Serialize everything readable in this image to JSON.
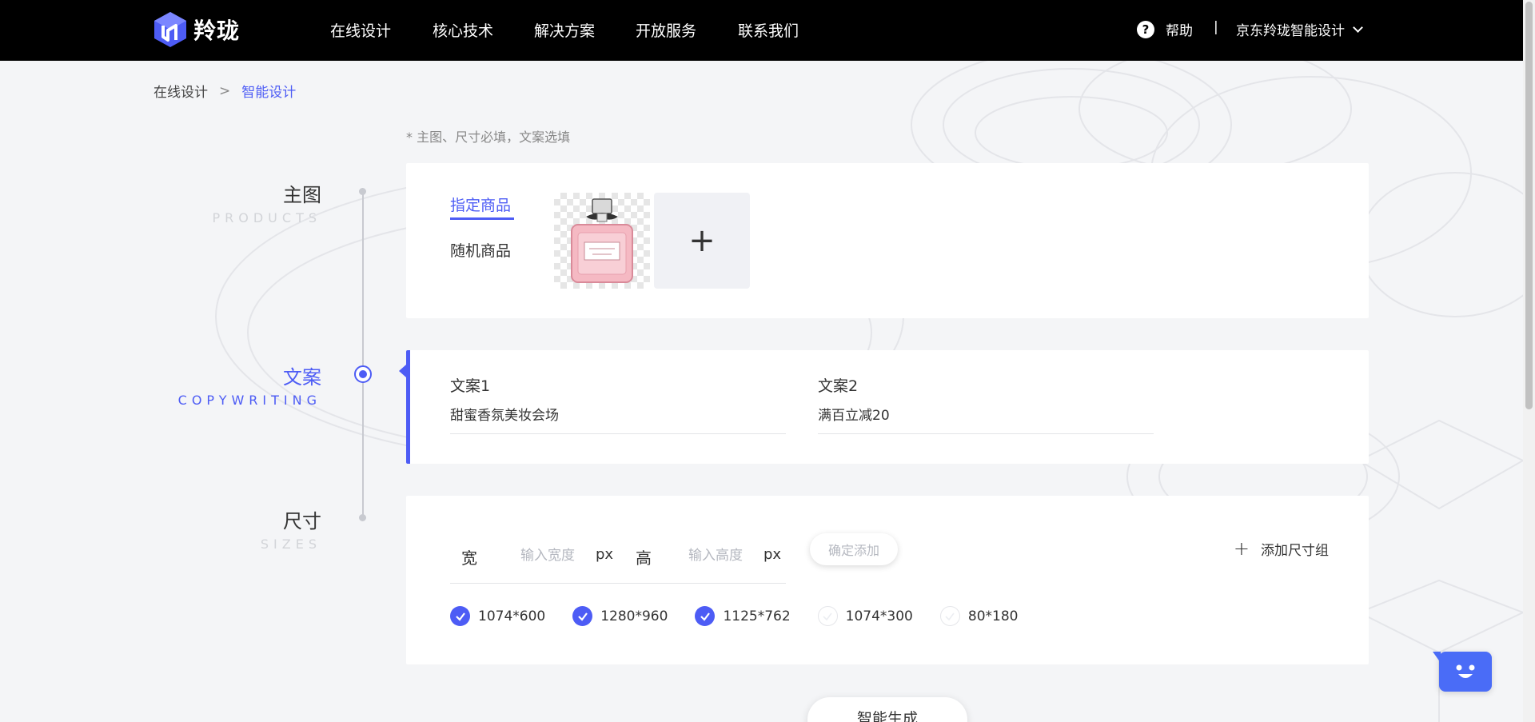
{
  "brand": {
    "logo_text": "羚珑",
    "accent_color": "#4d5cf5"
  },
  "nav": {
    "items": [
      "在线设计",
      "核心技术",
      "解决方案",
      "开放服务",
      "联系我们"
    ],
    "help_label": "帮助",
    "separator": "|",
    "account_label": "京东羚珑智能设计"
  },
  "breadcrumb": {
    "parent": "在线设计",
    "separator": ">",
    "current": "智能设计"
  },
  "required_note": "* 主图、尺寸必填，文案选填",
  "steps": [
    {
      "title": "主图",
      "subtitle": "PRODUCTS",
      "active": false
    },
    {
      "title": "文案",
      "subtitle": "COPYWRITING",
      "active": true
    },
    {
      "title": "尺寸",
      "subtitle": "SIZES",
      "active": false
    }
  ],
  "products": {
    "tabs": [
      "指定商品",
      "随机商品"
    ],
    "selected_tab": "指定商品",
    "add_symbol": "+"
  },
  "copywriting": {
    "fields": [
      {
        "label": "文案1",
        "value": "甜蜜香氛美妆会场"
      },
      {
        "label": "文案2",
        "value": "满百立减20"
      }
    ]
  },
  "sizes": {
    "width_label": "宽",
    "width_placeholder": "输入宽度",
    "height_label": "高",
    "height_placeholder": "输入高度",
    "unit": "px",
    "confirm_label": "确定添加",
    "add_group_label": "添加尺寸组",
    "add_group_symbol": "+",
    "options": [
      {
        "label": "1074*600",
        "checked": true
      },
      {
        "label": "1280*960",
        "checked": true
      },
      {
        "label": "1125*762",
        "checked": true
      },
      {
        "label": "1074*300",
        "checked": false
      },
      {
        "label": "80*180",
        "checked": false
      }
    ]
  },
  "generate_label": "智能生成"
}
